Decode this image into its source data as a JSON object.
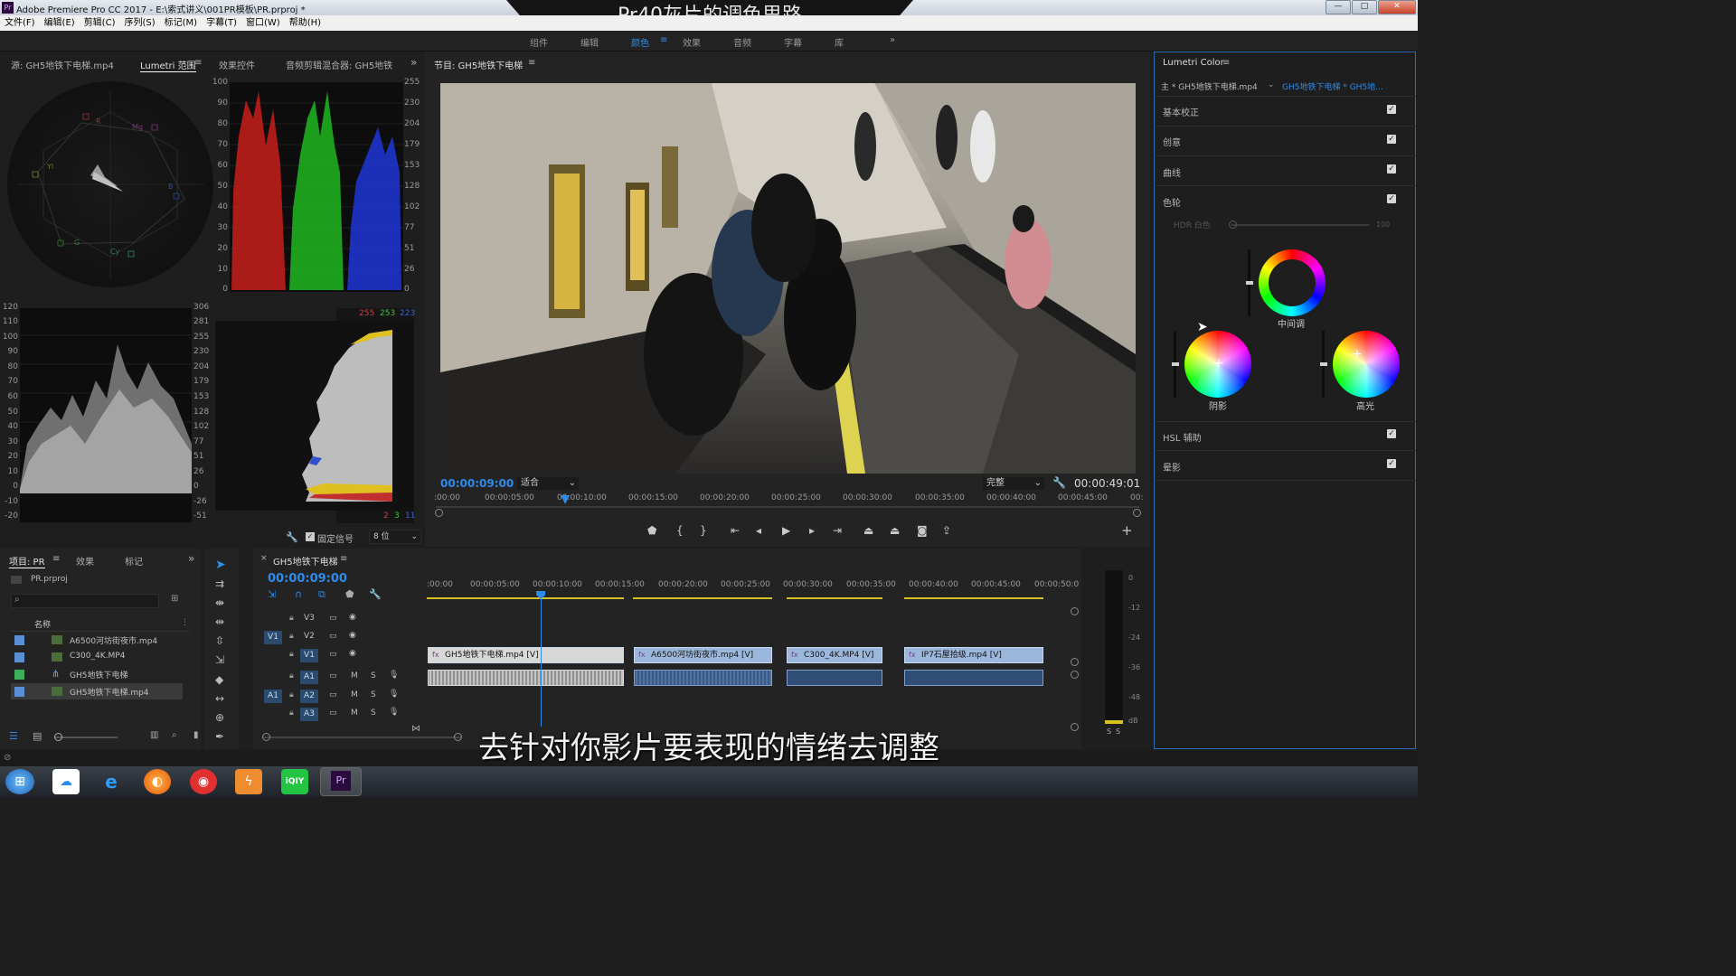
{
  "window": {
    "title": "Adobe Premiere Pro CC 2017 - E:\\索式讲义\\001PR模板\\PR.prproj *",
    "app_icon": "Pr",
    "minimize": "—",
    "maximize": "□",
    "close": "✕"
  },
  "overlay_title": "Pr40灰片的调色思路",
  "menu": [
    "文件(F)",
    "编辑(E)",
    "剪辑(C)",
    "序列(S)",
    "标记(M)",
    "字幕(T)",
    "窗口(W)",
    "帮助(H)"
  ],
  "workspaces": {
    "items": [
      "组件",
      "编辑",
      "颜色",
      "效果",
      "音频",
      "字幕",
      "库"
    ],
    "active": "颜色",
    "more": "»"
  },
  "scopes_panel": {
    "tabs": [
      "源: GH5地铁下电梯.mp4",
      "Lumetri 范围",
      "效果控件",
      "音频剪辑混合器: GH5地铁"
    ],
    "active_tab": "Lumetri 范围",
    "rgb_parade_left_scale": [
      "100",
      "90",
      "80",
      "70",
      "60",
      "50",
      "40",
      "30",
      "20",
      "10",
      "0"
    ],
    "rgb_parade_right_scale": [
      "255",
      "230",
      "204",
      "179",
      "153",
      "128",
      "102",
      "77",
      "51",
      "26",
      "0"
    ],
    "waveform_left_scale": [
      "120",
      "110",
      "100",
      "90",
      "80",
      "70",
      "60",
      "50",
      "40",
      "30",
      "20",
      "10",
      "0",
      "-10",
      "-20"
    ],
    "waveform_right_scale": [
      "306",
      "281",
      "255",
      "230",
      "204",
      "179",
      "153",
      "128",
      "102",
      "77",
      "51",
      "26",
      "0",
      "-26",
      "-51"
    ],
    "histogram_top_values": [
      "255",
      "253",
      "223"
    ],
    "histogram_bottom_values": [
      "2",
      "3",
      "11"
    ],
    "vectorscope_labels": [
      "R",
      "Mg",
      "B",
      "Cy",
      "G",
      "Yl"
    ],
    "clamp_label": "固定信号",
    "bit_depth": "8 位"
  },
  "program_monitor": {
    "title": "节目: GH5地铁下电梯",
    "timecode": "00:00:09:00",
    "fit": "适合",
    "quality": "完整",
    "duration": "00:00:49:01",
    "ruler": [
      ":00:00",
      "00:00:05:00",
      "00:00:10:00",
      "00:00:15:00",
      "00:00:20:00",
      "00:00:25:00",
      "00:00:30:00",
      "00:00:35:00",
      "00:00:40:00",
      "00:00:45:00",
      "00:"
    ],
    "playhead_fraction": 0.184
  },
  "lumetri": {
    "title": "Lumetri Color",
    "source_label": "主 * GH5地铁下电梯.mp4",
    "sequence_label": "GH5地铁下电梯 * GH5地...",
    "sections": [
      "基本校正",
      "创意",
      "曲线",
      "色轮",
      "HSL 辅助",
      "晕影"
    ],
    "hdr_label": "HDR 白色",
    "hdr_value": "100",
    "wheels": {
      "midtones": "中间调",
      "shadows": "阴影",
      "highlights": "高光"
    }
  },
  "project": {
    "tabs": [
      "项目: PR",
      "效果",
      "标记"
    ],
    "file": "PR.prproj",
    "name_header": "名称",
    "items": [
      {
        "name": "A6500河坊街夜市.mp4",
        "color": "#5a8fd6"
      },
      {
        "name": "C300_4K.MP4",
        "color": "#5a8fd6"
      },
      {
        "name": "GH5地铁下电梯",
        "color": "#3fae5a"
      },
      {
        "name": "GH5地铁下电梯.mp4",
        "color": "#5a8fd6"
      }
    ]
  },
  "timeline": {
    "title": "GH5地铁下电梯",
    "timecode": "00:00:09:00",
    "ruler": [
      ":00:00",
      "00:00:05:00",
      "00:00:10:00",
      "00:00:15:00",
      "00:00:20:00",
      "00:00:25:00",
      "00:00:30:00",
      "00:00:35:00",
      "00:00:40:00",
      "00:00:45:00",
      "00:00:50:0"
    ],
    "video_tracks": [
      "V3",
      "V2",
      "V1"
    ],
    "audio_tracks": [
      "A1",
      "A2",
      "A3"
    ],
    "source_v": "V1",
    "source_a": "A1",
    "mute": "M",
    "solo": "S",
    "clips": [
      "GH5地铁下电梯.mp4 [V]",
      "A6500河坊街夜市.mp4 [V]",
      "C300_4K.MP4 [V]",
      "IP7石屋拾级.mp4 [V]"
    ],
    "fx_badge": "fx"
  },
  "meter": {
    "scale": [
      "0",
      "-12",
      "-24",
      "-36",
      "-48",
      "dB"
    ],
    "solo_labels": [
      "S",
      "S"
    ]
  },
  "subtitle": "去针对你影片要表现的情绪去调整",
  "taskbar": {
    "items": [
      "start-icon",
      "baidu-netdisk-icon",
      "ie-icon",
      "firefox-icon",
      "netease-music-icon",
      "thunder-icon",
      "iqiyi-icon",
      "premiere-icon"
    ],
    "premiere": "Pr",
    "iqiyi": "iQIY"
  }
}
